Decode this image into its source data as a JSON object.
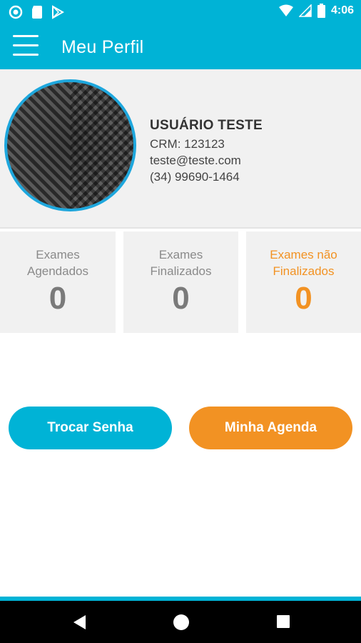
{
  "status_bar": {
    "time": "4:06",
    "left_icons": [
      "circle-notification-icon",
      "sd-card-icon",
      "play-store-icon"
    ],
    "right_icons": [
      "wifi-icon",
      "signal-icon",
      "battery-icon"
    ]
  },
  "app_bar": {
    "menu_icon": "hamburger-menu-icon",
    "title": "Meu Perfil"
  },
  "profile": {
    "name": "USUÁRIO TESTE",
    "crm": "CRM: 123123",
    "email": "teste@teste.com",
    "phone": "(34) 99690-1464"
  },
  "stats": [
    {
      "label_line1": "Exames",
      "label_line2": "Agendados",
      "value": "0"
    },
    {
      "label_line1": "Exames",
      "label_line2": "Finalizados",
      "value": "0"
    },
    {
      "label_line1": "Exames não",
      "label_line2": "Finalizados",
      "value": "0"
    }
  ],
  "buttons": {
    "change_password": "Trocar Senha",
    "my_schedule": "Minha Agenda"
  },
  "colors": {
    "primary": "#00b3d6",
    "accent": "#f29223",
    "card_bg": "#f1f1f1"
  },
  "nav": [
    "back-icon",
    "home-icon",
    "recents-icon"
  ]
}
